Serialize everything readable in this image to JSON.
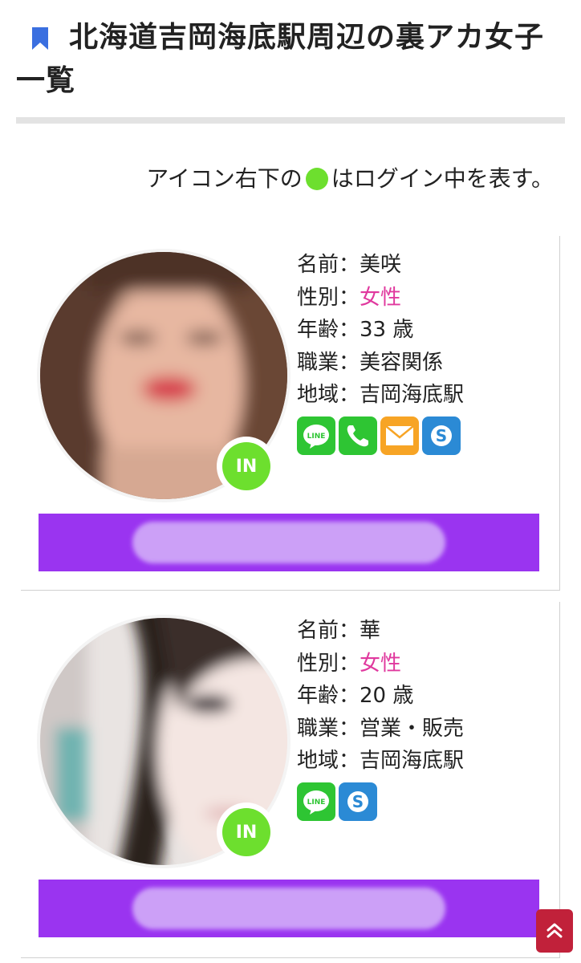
{
  "header": {
    "title": "北海道吉岡海底駅周辺の裏アカ女子一覧"
  },
  "legend": {
    "before_dot": "アイコン右下の",
    "after_dot": "はログイン中を表す。"
  },
  "profiles": [
    {
      "badge": "IN",
      "rows": [
        {
          "label": "名前",
          "value": "美咲"
        },
        {
          "label": "性別",
          "value": "女性"
        },
        {
          "label": "年齢",
          "value": "33 歳"
        },
        {
          "label": "職業",
          "value": "美容関係"
        },
        {
          "label": "地域",
          "value": "吉岡海底駅"
        }
      ],
      "contact_icons": [
        "line-icon",
        "phone-icon",
        "mail-icon",
        "skype-icon"
      ]
    },
    {
      "badge": "IN",
      "rows": [
        {
          "label": "名前",
          "value": "華"
        },
        {
          "label": "性別",
          "value": "女性"
        },
        {
          "label": "年齢",
          "value": "20 歳"
        },
        {
          "label": "職業",
          "value": "営業・販売"
        },
        {
          "label": "地域",
          "value": "吉岡海底駅"
        }
      ],
      "contact_icons": [
        "line-icon",
        "skype-icon"
      ]
    }
  ],
  "separator": "：",
  "colors": {
    "accent_purple": "#9a34f0",
    "online_green": "#6ddf2e",
    "female_pink": "#e0399e",
    "bookmark_blue": "#3a6fe0",
    "scroll_top_red": "#c1213a"
  },
  "icons": {
    "bookmark": "bookmark-icon",
    "scroll_top": "double-chevron-up-icon"
  }
}
